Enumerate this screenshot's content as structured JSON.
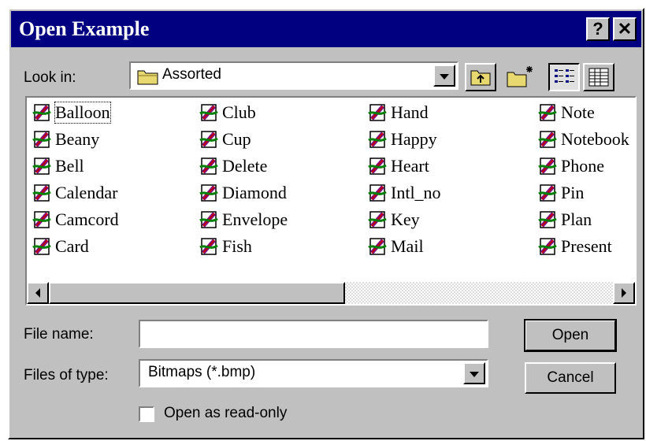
{
  "dialog": {
    "title": "Open Example",
    "help_glyph": "?",
    "close_glyph": "✕"
  },
  "look_in": {
    "label": "Look in:",
    "value": "Assorted",
    "folder_icon": "folder-icon"
  },
  "toolbar": {
    "icons": [
      "up-one-level-icon",
      "create-new-folder-icon",
      "list-view-icon",
      "details-view-icon"
    ]
  },
  "files": {
    "icon": "bitmap-file-icon",
    "columns": [
      [
        "Balloon",
        "Beany",
        "Bell",
        "Calendar",
        "Camcord",
        "Card"
      ],
      [
        "Club",
        "Cup",
        "Delete",
        "Diamond",
        "Envelope",
        "Fish"
      ],
      [
        "Hand",
        "Happy",
        "Heart",
        "Intl_no",
        "Key",
        "Mail"
      ],
      [
        "Note",
        "Notebook",
        "Phone",
        "Pin",
        "Plan",
        "Present"
      ]
    ]
  },
  "file_name": {
    "label": "File name:",
    "value": ""
  },
  "files_of_type": {
    "label": "Files of type:",
    "value": "Bitmaps (*.bmp)"
  },
  "buttons": {
    "open": "Open",
    "cancel": "Cancel"
  },
  "read_only": {
    "label": "Open as read-only",
    "checked": false
  },
  "colors": {
    "title_bar": "#000080",
    "face": "#c0c0c0"
  }
}
